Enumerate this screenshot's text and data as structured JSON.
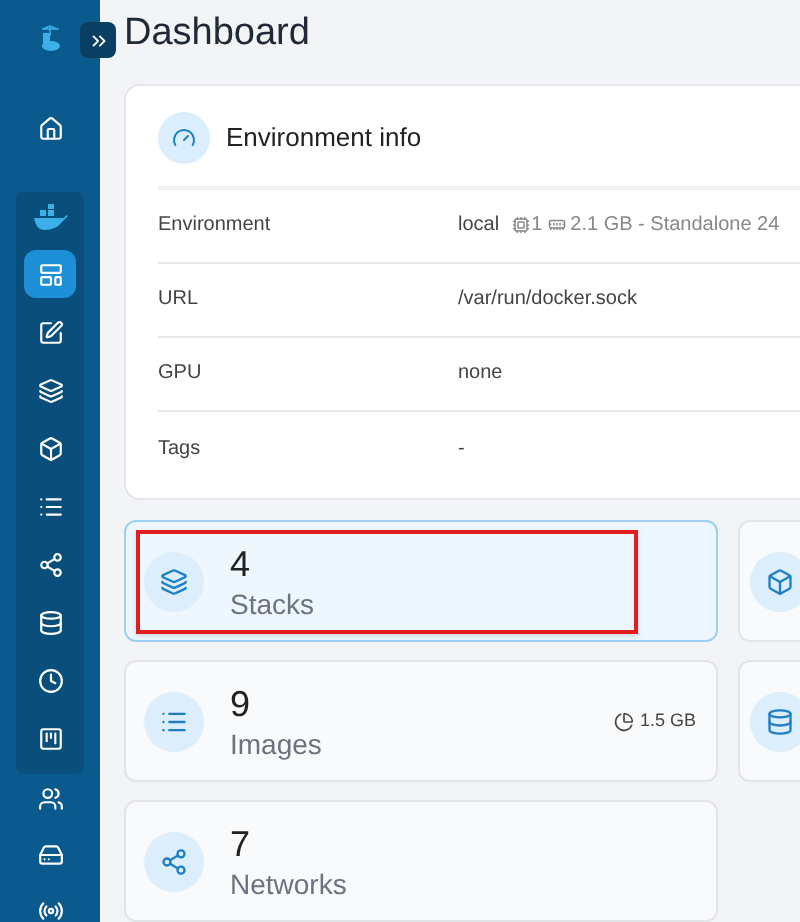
{
  "page_title": "Dashboard",
  "sidebar": {
    "top_items": [
      {
        "kind": "home",
        "selected": false
      }
    ],
    "environment_items": [
      {
        "kind": "dashboard",
        "selected": true
      },
      {
        "kind": "edit",
        "selected": false
      },
      {
        "kind": "layers",
        "selected": false
      },
      {
        "kind": "box",
        "selected": false
      },
      {
        "kind": "list",
        "selected": false
      },
      {
        "kind": "share",
        "selected": false
      },
      {
        "kind": "database",
        "selected": false
      },
      {
        "kind": "clock",
        "selected": false
      },
      {
        "kind": "board",
        "selected": false
      }
    ],
    "bottom_items": [
      {
        "kind": "users",
        "selected": false
      },
      {
        "kind": "drive",
        "selected": false
      },
      {
        "kind": "radio",
        "selected": false
      }
    ]
  },
  "environment_info": {
    "title": "Environment info",
    "rows": [
      {
        "label": "Environment",
        "value": "local",
        "cpu": "1",
        "memory": "2.1 GB - Standalone 24"
      },
      {
        "label": "URL",
        "value": "/var/run/docker.sock"
      },
      {
        "label": "GPU",
        "value": "none"
      },
      {
        "label": "Tags",
        "value": "-"
      }
    ]
  },
  "stat_cards": [
    {
      "kind": "layers",
      "count": "4",
      "label": "Stacks",
      "selected": true,
      "annotated": true
    },
    {
      "kind": "list",
      "count": "9",
      "label": "Images",
      "selected": false,
      "annotated": false,
      "size": "1.5 GB"
    },
    {
      "kind": "share",
      "count": "7",
      "label": "Networks",
      "selected": false,
      "annotated": false
    }
  ]
}
